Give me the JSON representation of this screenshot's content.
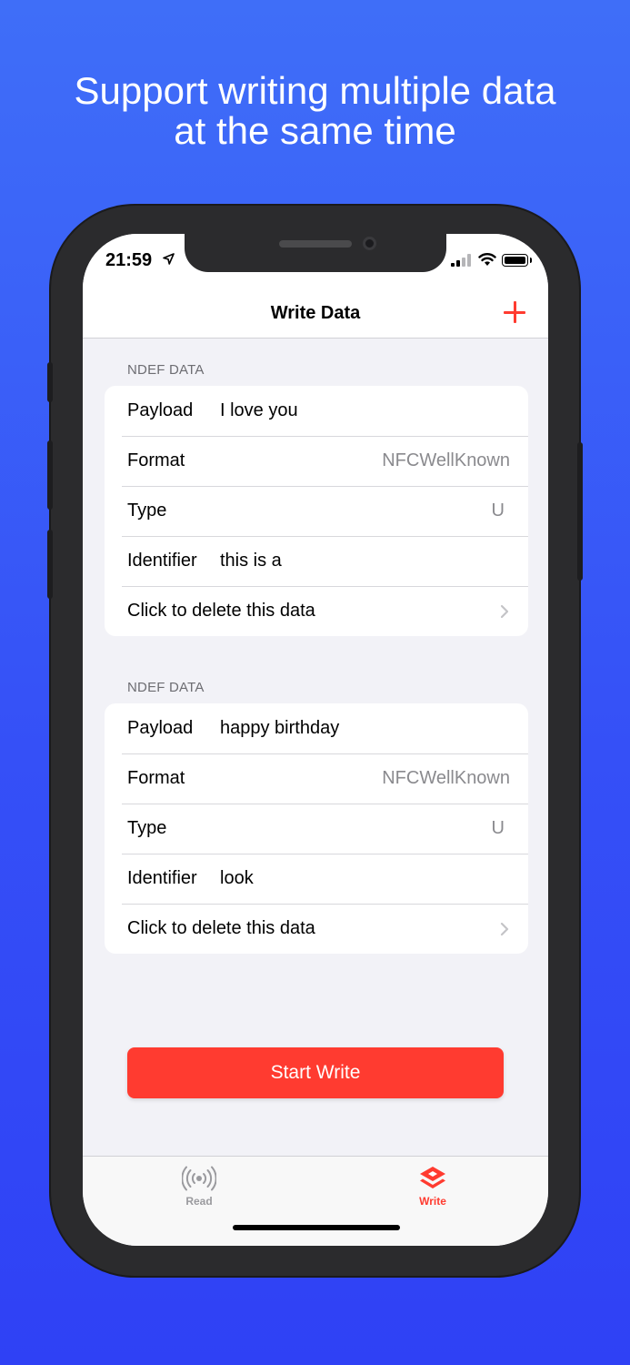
{
  "headline": {
    "line1": "Support writing multiple data",
    "line2": "at the same time"
  },
  "status_bar": {
    "time": "21:59"
  },
  "navbar": {
    "title": "Write Data",
    "add_icon": "plus-icon"
  },
  "sections": [
    {
      "header": "NDEF DATA",
      "rows": {
        "payload_label": "Payload",
        "payload_value": "I love you",
        "format_label": "Format",
        "format_value": "NFCWellKnown",
        "type_label": "Type",
        "type_value": "U",
        "identifier_label": "Identifier",
        "identifier_value": "this is a",
        "delete_label": "Click to delete this data"
      }
    },
    {
      "header": "NDEF DATA",
      "rows": {
        "payload_label": "Payload",
        "payload_value": "happy birthday",
        "format_label": "Format",
        "format_value": "NFCWellKnown",
        "type_label": "Type",
        "type_value": "U",
        "identifier_label": "Identifier",
        "identifier_value": "look",
        "delete_label": "Click to delete this data"
      }
    }
  ],
  "start_button": {
    "label": "Start Write"
  },
  "tabs": [
    {
      "label": "Read",
      "icon": "nfc-signal-icon",
      "active": false
    },
    {
      "label": "Write",
      "icon": "write-layers-icon",
      "active": true
    }
  ],
  "colors": {
    "accent": "#ff3b30",
    "background_top": "#3f6ef8",
    "background_bottom": "#2f41f5",
    "secondary_text": "#8a8a8e"
  }
}
